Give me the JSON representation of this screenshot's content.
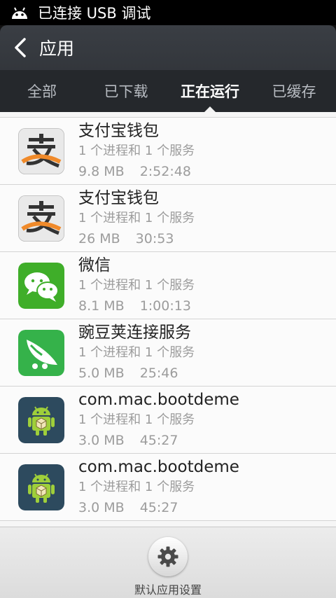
{
  "status_bar": {
    "usb_text": "已连接 USB 调试",
    "icon": "android-debug-icon"
  },
  "header": {
    "title": "应用",
    "back_icon": "chevron-left-icon"
  },
  "tabs": [
    {
      "label": "全部",
      "active": false
    },
    {
      "label": "已下载",
      "active": false
    },
    {
      "label": "正在运行",
      "active": true
    },
    {
      "label": "已缓存",
      "active": false
    }
  ],
  "apps": [
    {
      "name": "支付宝钱包",
      "detail": "1 个进程和 1 个服务",
      "size": "9.8 MB",
      "time": "2:52:48",
      "icon": "alipay-icon"
    },
    {
      "name": "支付宝钱包",
      "detail": "1 个进程和 1 个服务",
      "size": "26 MB",
      "time": "30:53",
      "icon": "alipay-icon"
    },
    {
      "name": "微信",
      "detail": "1 个进程和 1 个服务",
      "size": "8.1 MB",
      "time": "1:00:13",
      "icon": "wechat-icon"
    },
    {
      "name": "豌豆荚连接服务",
      "detail": "1 个进程和 1 个服务",
      "size": "5.0 MB",
      "time": "25:46",
      "icon": "wandoujia-icon"
    },
    {
      "name": "com.mac.bootdeme",
      "detail": "1 个进程和 1 个服务",
      "size": "3.0 MB",
      "time": "45:27",
      "icon": "android-app-icon"
    },
    {
      "name": "com.mac.bootdeme",
      "detail": "1 个进程和 1 个服务",
      "size": "3.0 MB",
      "time": "45:27",
      "icon": "android-app-icon"
    }
  ],
  "footer": {
    "button_label": "默认应用设置",
    "icon": "gear-icon"
  }
}
